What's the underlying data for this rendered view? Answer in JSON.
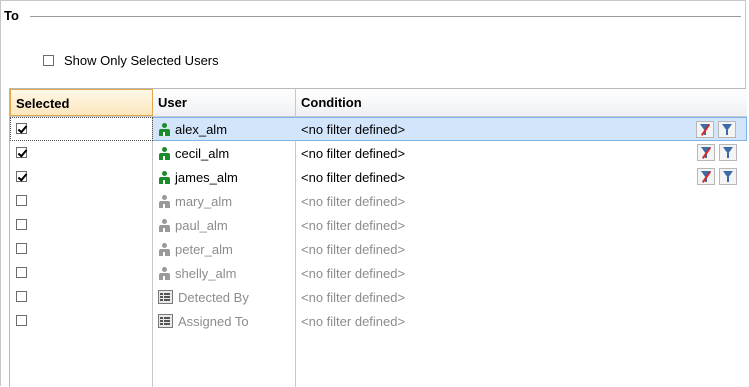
{
  "section": {
    "title": "To"
  },
  "show_only": {
    "label": "Show Only Selected Users",
    "checked": false
  },
  "columns": {
    "selected": "Selected",
    "user": "User",
    "condition": "Condition"
  },
  "rows": [
    {
      "checked": true,
      "type": "user",
      "name": "alex_alm",
      "condition": "<no filter defined>",
      "active": true,
      "highlight": true
    },
    {
      "checked": true,
      "type": "user",
      "name": "cecil_alm",
      "condition": "<no filter defined>",
      "active": true,
      "highlight": false
    },
    {
      "checked": true,
      "type": "user",
      "name": "james_alm",
      "condition": "<no filter defined>",
      "active": true,
      "highlight": false
    },
    {
      "checked": false,
      "type": "user",
      "name": "mary_alm",
      "condition": "<no filter defined>",
      "active": false,
      "highlight": false
    },
    {
      "checked": false,
      "type": "user",
      "name": "paul_alm",
      "condition": "<no filter defined>",
      "active": false,
      "highlight": false
    },
    {
      "checked": false,
      "type": "user",
      "name": "peter_alm",
      "condition": "<no filter defined>",
      "active": false,
      "highlight": false
    },
    {
      "checked": false,
      "type": "user",
      "name": "shelly_alm",
      "condition": "<no filter defined>",
      "active": false,
      "highlight": false
    },
    {
      "checked": false,
      "type": "field",
      "name": "Detected By",
      "condition": "<no filter defined>",
      "active": false,
      "highlight": false
    },
    {
      "checked": false,
      "type": "field",
      "name": "Assigned To",
      "condition": "<no filter defined>",
      "active": false,
      "highlight": false
    }
  ],
  "colors": {
    "active_icon": "#1a8c2c",
    "inactive_icon": "#9a9a9a",
    "inactive_text": "#8c8c8c",
    "row_highlight": "#d3e5fa"
  },
  "icons": {
    "user": "user-icon",
    "field": "field-icon",
    "clear_filter": "clear-filter-icon",
    "set_filter": "filter-icon"
  }
}
